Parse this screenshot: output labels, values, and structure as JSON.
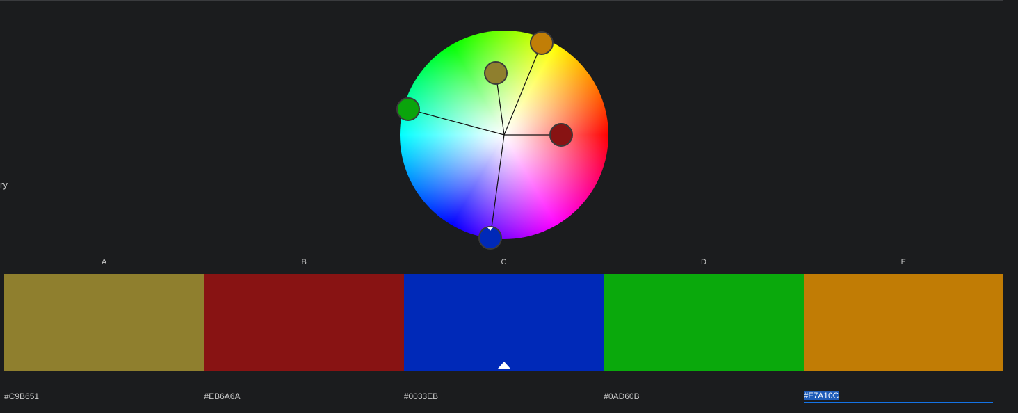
{
  "side_fragment": "ry",
  "wheel": {
    "handles": [
      {
        "name": "A",
        "color": "#8f7f2e"
      },
      {
        "name": "B",
        "color": "#881313"
      },
      {
        "name": "C",
        "color": "#0029b8",
        "selected": true
      },
      {
        "name": "D",
        "color": "#0aa40c"
      },
      {
        "name": "E",
        "color": "#c17e07"
      }
    ]
  },
  "swatches": [
    {
      "label": "A",
      "fill": "#8f7f2e",
      "hex": "#C9B651"
    },
    {
      "label": "B",
      "fill": "#881313",
      "hex": "#EB6A6A"
    },
    {
      "label": "C",
      "fill": "#0029b8",
      "hex": "#0033EB",
      "selected": true
    },
    {
      "label": "D",
      "fill": "#0aa90c",
      "hex": "#0AD60B"
    },
    {
      "label": "E",
      "fill": "#c17c05",
      "hex": "#F7A10C",
      "active_input": true
    }
  ]
}
